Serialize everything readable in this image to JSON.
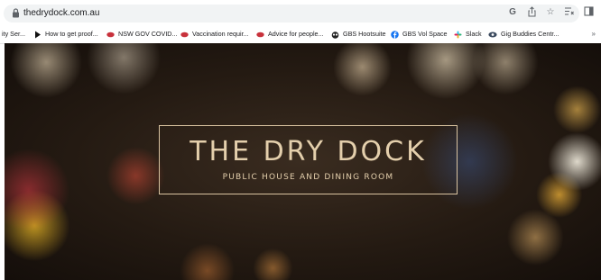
{
  "address_bar": {
    "url": "thedrydock.com.au",
    "icons": [
      "lock-icon",
      "google-icon",
      "share-icon",
      "star-icon",
      "reading-list-icon",
      "side-panel-icon"
    ]
  },
  "bookmarks": {
    "items": [
      {
        "label": "ity Ser...",
        "icon": "none"
      },
      {
        "label": "How to get proof...",
        "icon": "play-icon"
      },
      {
        "label": "NSW GOV COVID...",
        "icon": "waratah-icon"
      },
      {
        "label": "Vaccination requir...",
        "icon": "waratah-icon"
      },
      {
        "label": "Advice for people...",
        "icon": "waratah-icon"
      },
      {
        "label": "GBS Hootsuite",
        "icon": "owl-icon"
      },
      {
        "label": "GBS Vol Space",
        "icon": "facebook-icon"
      },
      {
        "label": "Slack",
        "icon": "slack-icon"
      },
      {
        "label": "Gig Buddies Centr...",
        "icon": "eye-icon"
      }
    ],
    "more_label": "»"
  },
  "hero": {
    "title": "THE DRY DOCK",
    "subtitle": "PUBLIC HOUSE AND DINING ROOM"
  },
  "colors": {
    "logo_text": "#e4cfac",
    "waratah_red": "#c8323c",
    "facebook_blue": "#1877f2"
  }
}
